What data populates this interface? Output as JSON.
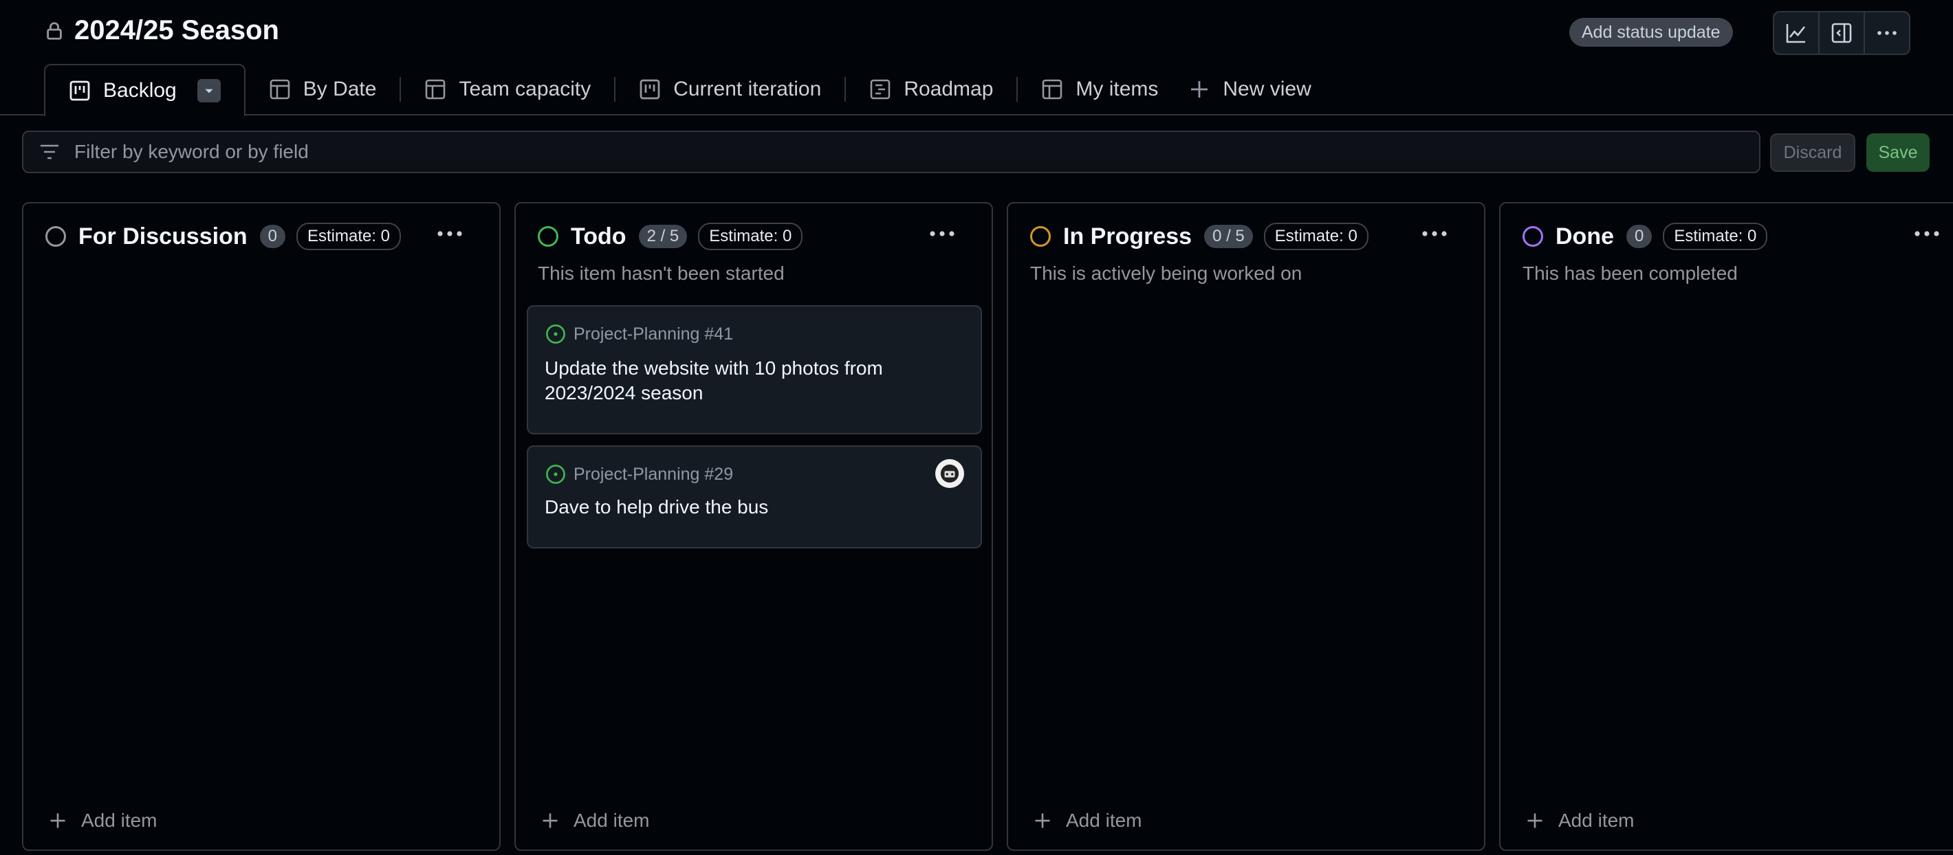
{
  "project": {
    "title": "2024/25 Season"
  },
  "header": {
    "status_update_label": "Add status update",
    "icons": [
      "insights-icon",
      "sidebar-icon",
      "more-options-icon"
    ]
  },
  "tabs": [
    {
      "label": "Backlog",
      "icon": "board-icon"
    },
    {
      "label": "By Date",
      "icon": "table-icon"
    },
    {
      "label": "Team capacity",
      "icon": "table-icon"
    },
    {
      "label": "Current iteration",
      "icon": "board-icon"
    },
    {
      "label": "Roadmap",
      "icon": "roadmap-icon"
    },
    {
      "label": "My items",
      "icon": "table-icon"
    },
    {
      "label": "New view",
      "icon": "plus-icon"
    }
  ],
  "filter": {
    "placeholder": "Filter by keyword or by field",
    "discard_label": "Discard",
    "save_label": "Save"
  },
  "columns": [
    {
      "title": "For Discussion",
      "count": "0",
      "estimate": "Estimate: 0",
      "description": "",
      "status_color": "#9198a1",
      "add_label": "Add item"
    },
    {
      "title": "Todo",
      "count": "2 / 5",
      "estimate": "Estimate: 0",
      "description": "This item hasn't been started",
      "status_color": "#3fb950",
      "add_label": "Add item",
      "cards": [
        {
          "ref": "Project-Planning #41",
          "title": "Update the website with 10 photos from 2023/2024 season"
        },
        {
          "ref": "Project-Planning #29",
          "title": "Dave to help drive the bus"
        }
      ]
    },
    {
      "title": "In Progress",
      "count": "0 / 5",
      "estimate": "Estimate: 0",
      "description": "This is actively being worked on",
      "status_color": "#d29922",
      "add_label": "Add item"
    },
    {
      "title": "Done",
      "count": "0",
      "estimate": "Estimate: 0",
      "description": "This has been completed",
      "status_color": "#a371f7",
      "add_label": "Add item"
    }
  ],
  "colors": {
    "background": "#010409",
    "border": "#30363d",
    "accent_green": "#3fb950",
    "save_green": "#1f4f2b"
  }
}
